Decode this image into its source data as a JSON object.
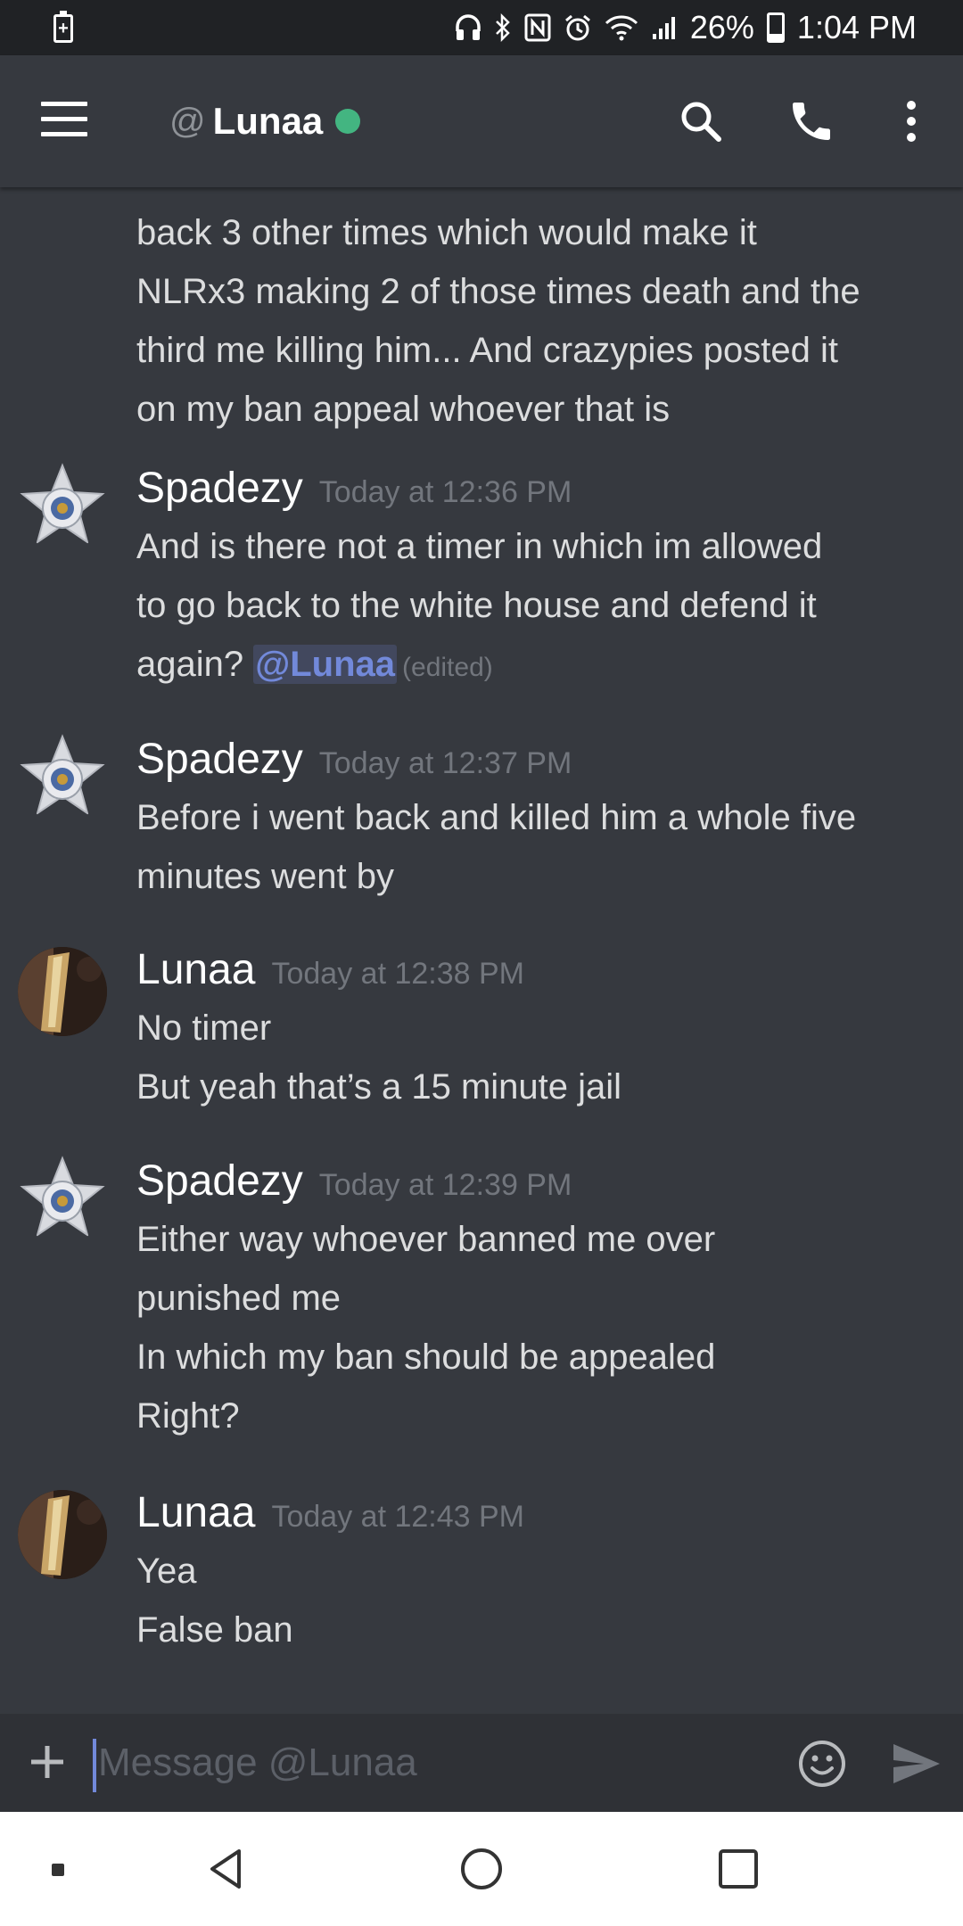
{
  "status_bar": {
    "battery_percent": "26%",
    "time": "1:04 PM",
    "icons": [
      "battery-charging-icon",
      "headphones-icon",
      "bluetooth-icon",
      "nfc-icon",
      "alarm-icon",
      "wifi-icon",
      "signal-icon",
      "battery-icon"
    ]
  },
  "header": {
    "at_symbol": "@",
    "channel_name": "Lunaa",
    "status_color": "#43b581",
    "icons": [
      "menu-icon",
      "search-icon",
      "phone-icon",
      "more-vertical-icon"
    ]
  },
  "messages": {
    "continuation": {
      "lines": [
        "back 3 other times which would make it",
        "NLRx3 making 2 of those times death and the",
        "third me killing him... And crazypies posted it",
        "on my ban appeal whoever that is"
      ]
    },
    "groups": [
      {
        "author": "Spadezy",
        "timestamp": "Today at 12:36 PM",
        "avatar": "sheriff-badge-avatar",
        "lines": [
          "And is there not a timer in which im allowed",
          "to go back to the white house and defend it"
        ],
        "last_line_prefix": "again? ",
        "mention": "@Lunaa",
        "edited": "(edited)"
      },
      {
        "author": "Spadezy",
        "timestamp": "Today at 12:37 PM",
        "avatar": "sheriff-badge-avatar",
        "lines": [
          "Before i went back and killed him a whole five",
          "minutes went by"
        ]
      },
      {
        "author": "Lunaa",
        "timestamp": "Today at 12:38 PM",
        "avatar": "photo-avatar",
        "lines": [
          "No timer",
          "But yeah that’s a 15 minute jail"
        ]
      },
      {
        "author": "Spadezy",
        "timestamp": "Today at 12:39 PM",
        "avatar": "sheriff-badge-avatar",
        "lines": [
          "Either way whoever banned me over",
          "punished me",
          "In which my ban should be appealed",
          "Right?"
        ]
      },
      {
        "author": "Lunaa",
        "timestamp": "Today at 12:43 PM",
        "avatar": "photo-avatar",
        "lines": [
          "Yea",
          "False ban"
        ]
      }
    ]
  },
  "composer": {
    "placeholder": "Message @Lunaa",
    "accent": "#7289da"
  },
  "colors": {
    "background": "#36393f",
    "status_bar": "#202225",
    "composer": "#2f3136",
    "mention": "#7289da"
  }
}
